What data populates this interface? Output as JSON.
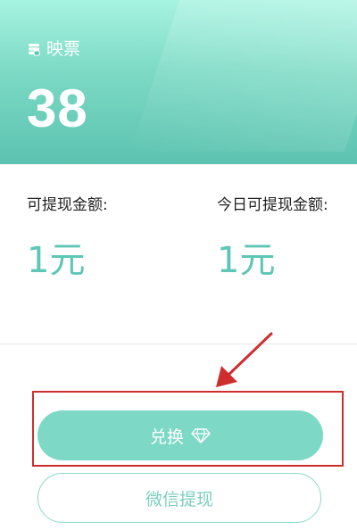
{
  "header": {
    "ticket_label": "映票",
    "ticket_count": "38"
  },
  "withdrawable": {
    "label": "可提现金额:",
    "value": "1元"
  },
  "today_withdrawable": {
    "label": "今日可提现金额:",
    "value": "1元"
  },
  "buttons": {
    "exchange_label": "兑换",
    "wechat_withdraw_label": "微信提现"
  },
  "colors": {
    "header_gradient_top": "#a6f3e1",
    "header_gradient_bottom": "#5cc3b0",
    "accent": "#5ec6b6",
    "exchange_button": "#7dd9c6",
    "annotation_red": "#cf2e2e"
  },
  "icons": {
    "ticket": "ticket-stack-icon",
    "exchange": "diamond-icon",
    "annotation": "red-arrow"
  }
}
